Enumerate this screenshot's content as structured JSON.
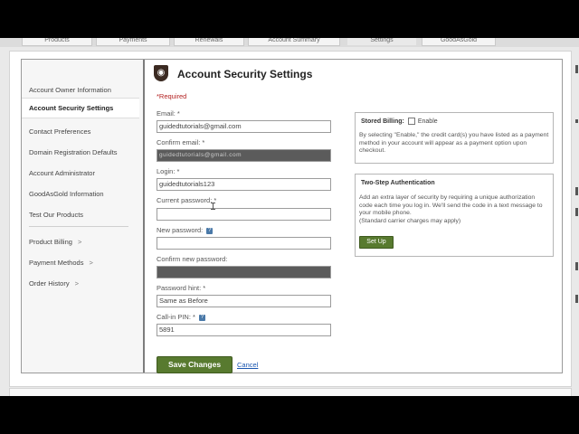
{
  "tabs": [
    "Products",
    "Payments",
    "Renewals",
    "Account Summary",
    "Settings",
    "GoodAsGold"
  ],
  "sidebar": {
    "items": [
      {
        "label": "Account Owner Information"
      },
      {
        "label": "Account Security Settings"
      },
      {
        "label": "Contact Preferences"
      },
      {
        "label": "Domain Registration Defaults"
      },
      {
        "label": "Account Administrator"
      },
      {
        "label": "GoodAsGold Information"
      },
      {
        "label": "Test Our Products"
      }
    ],
    "subitems": [
      {
        "label": "Product Billing",
        "chevron": ">"
      },
      {
        "label": "Payment Methods",
        "chevron": ">"
      },
      {
        "label": "Order History",
        "chevron": ">"
      }
    ]
  },
  "page": {
    "title": "Account Security Settings",
    "required_note": "*Required"
  },
  "form": {
    "email_label": "Email: *",
    "email_value": "guidedtutorials@gmail.com",
    "confirm_email_label": "Confirm email: *",
    "confirm_email_value": "guidedtutorials@gmail.com",
    "login_label": "Login: *",
    "login_value": "guidedtutorials123",
    "current_password_label": "Current password: *",
    "new_password_label": "New password:",
    "confirm_new_password_label": "Confirm new password:",
    "password_hint_label": "Password hint: *",
    "password_hint_value": "Same as Before",
    "call_in_pin_label": "Call-in PIN: *",
    "call_in_pin_value": "5891",
    "save_label": "Save Changes",
    "cancel_label": "Cancel"
  },
  "stored_billing": {
    "title": "Stored Billing:",
    "checkbox_label": "Enable",
    "description": "By selecting \"Enable,\" the credit card(s) you have listed as a payment method in your account will appear as a payment option upon checkout."
  },
  "two_step": {
    "title": "Two-Step Authentication",
    "description": "Add an extra layer of security by requiring a unique authorization code each time you log in. We'll send the code in a text message to your mobile phone.",
    "note": "(Standard carrier charges may apply)",
    "button_label": "Set Up"
  },
  "colors": {
    "accent_green": "#587a2f",
    "required_red": "#b32020",
    "link_blue": "#1a56b0",
    "help_blue": "#4a79a8"
  }
}
